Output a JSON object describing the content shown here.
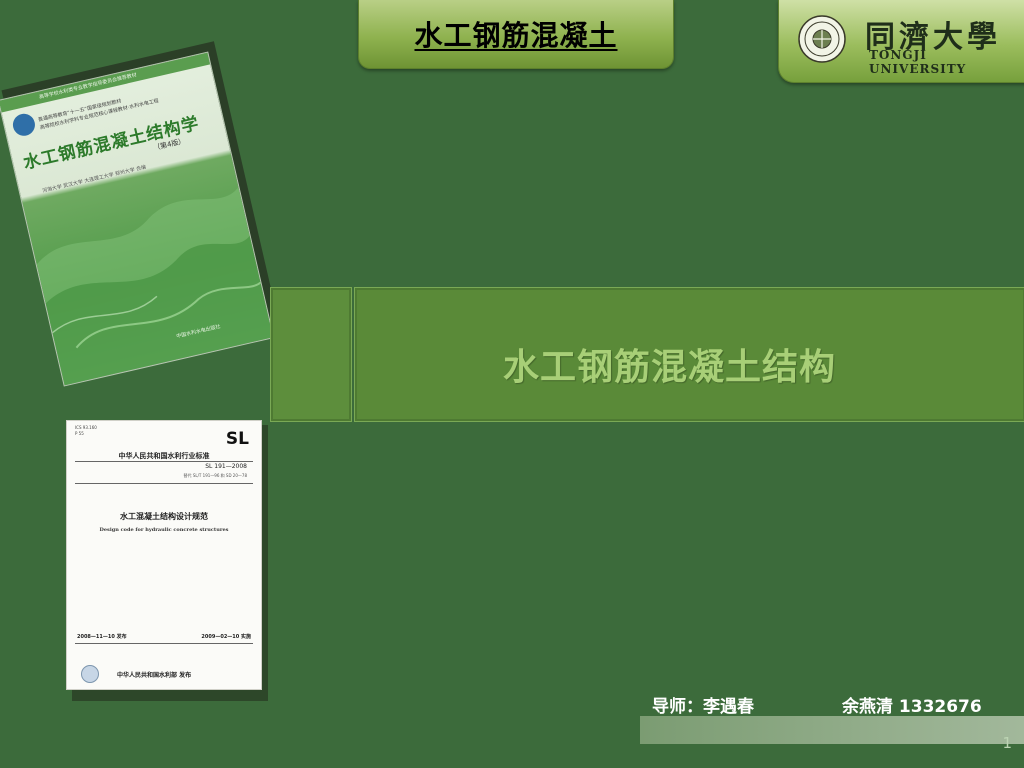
{
  "header": {
    "title": "水工钢筋混凝土",
    "logo_cn": "同濟大學",
    "logo_en": "TONGJI UNIVERSITY"
  },
  "textbook": {
    "band_text": "高等学校水利类专业教学指导委员会推荐教材",
    "subtitle_line1": "普通高等教育“十一五”国家级规划教材",
    "subtitle_line2": "高等院校水利学科专业规范核心课程教材·水利水电工程",
    "title": "水工钢筋混凝土结构学",
    "edition": "（第4版）",
    "authors": "河海大学  武汉大学  大连理工大学  郑州大学  合编",
    "publisher": "中国水利水电出版社"
  },
  "standard": {
    "ics_line1": "ICS 93.160",
    "ics_line2": "P 55",
    "mark": "SL",
    "org": "中华人民共和国水利行业标准",
    "number": "SL 191—2008",
    "replaces": "替代 SL/T 191—96 和 SD 20—78",
    "title_cn": "水工混凝土结构设计规范",
    "title_en": "Design code for hydraulic concrete structures",
    "issue_date": "2008—11—10 发布",
    "impl_date": "2009—02—10 实施",
    "publisher": "中华人民共和国水利部   发布"
  },
  "main": {
    "title": "水工钢筋混凝土结构"
  },
  "footer": {
    "advisor": "导师：李遇春",
    "student": "余燕清   1332676",
    "page": "1"
  },
  "colors": {
    "background": "#3c6b3b",
    "tab_green": "#8fb24f",
    "title_text": "#a8cf77",
    "bar_fill": "#5a8a38"
  }
}
